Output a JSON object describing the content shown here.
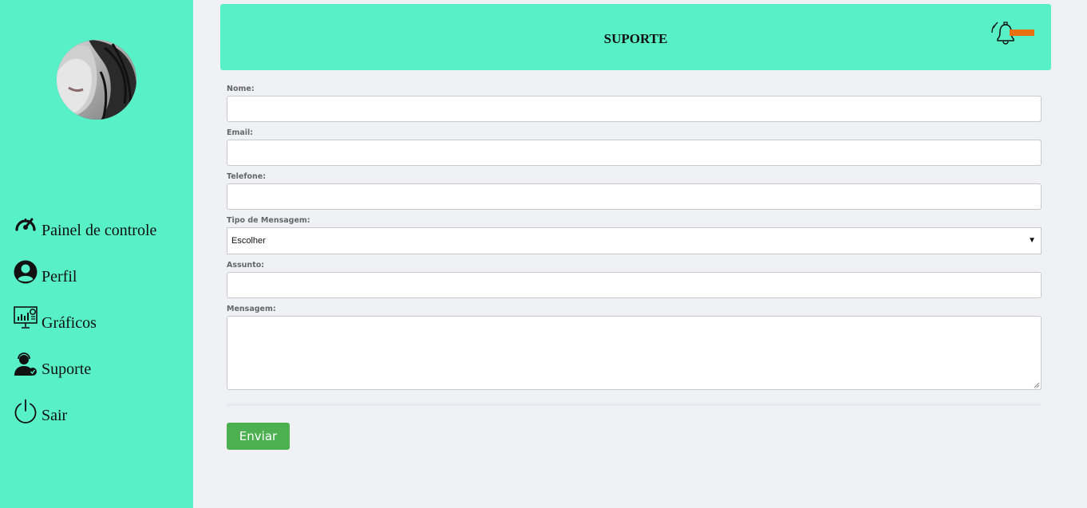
{
  "sidebar": {
    "avatar_alt": "user-avatar",
    "items": [
      {
        "label": "Painel de controle",
        "icon": "speedometer-icon"
      },
      {
        "label": "Perfil",
        "icon": "user-circle-icon"
      },
      {
        "label": "Gráficos",
        "icon": "chart-monitor-icon"
      },
      {
        "label": "Suporte",
        "icon": "support-agent-icon"
      },
      {
        "label": "Sair",
        "icon": "power-icon"
      }
    ]
  },
  "header": {
    "title": "SUPORTE",
    "notification_icon": "bell-icon",
    "notification_color": "#e8700f"
  },
  "form": {
    "name_label": "Nome:",
    "name_value": "",
    "email_label": "Email:",
    "email_value": "",
    "phone_label": "Telefone:",
    "phone_value": "",
    "type_label": "Tipo de Mensagem:",
    "type_selected": "Escolher",
    "subject_label": "Assunto:",
    "subject_value": "",
    "message_label": "Mensagem:",
    "message_value": "",
    "submit_label": "Enviar"
  },
  "colors": {
    "accent": "#58f0c7",
    "background": "#f0f1f5",
    "submit": "#4caf50"
  }
}
